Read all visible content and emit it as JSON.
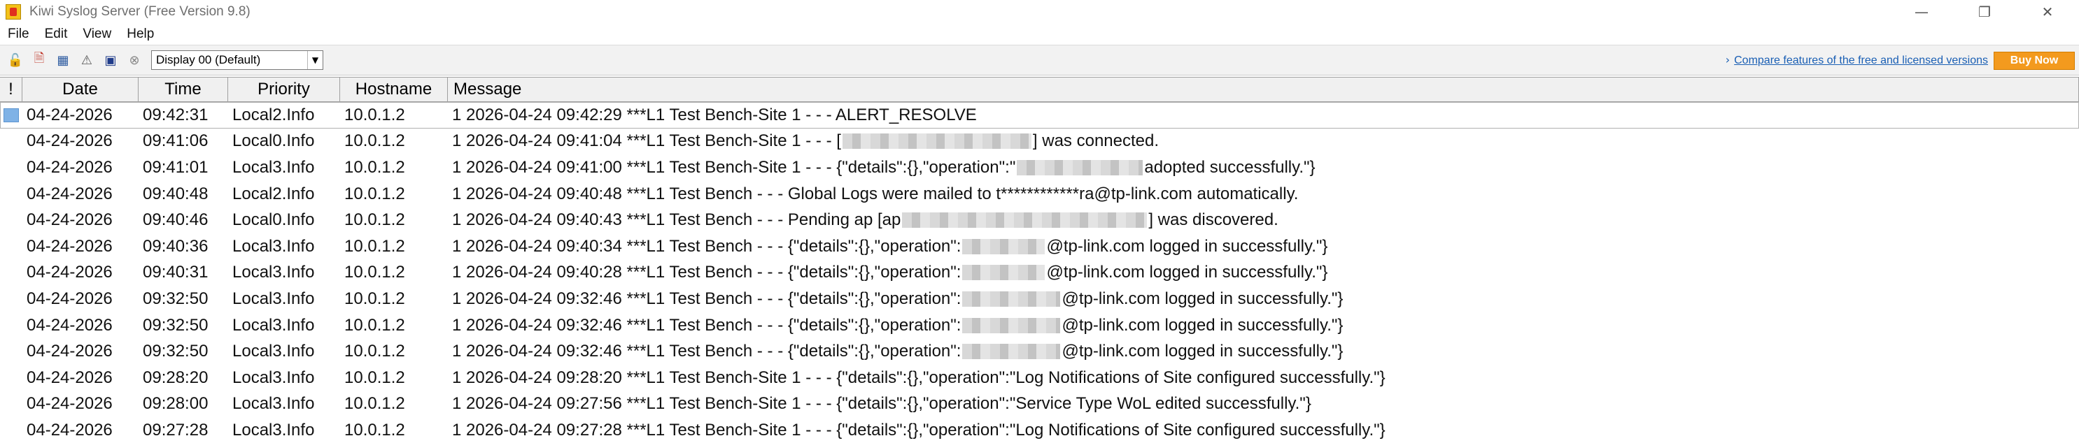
{
  "window": {
    "title": "Kiwi Syslog Server (Free Version 9.8)",
    "controls": {
      "minimize": "—",
      "restore": "❐",
      "close": "✕"
    }
  },
  "menu": {
    "items": [
      "File",
      "Edit",
      "View",
      "Help"
    ]
  },
  "toolbar": {
    "icons": [
      "lock-icon",
      "document-icon",
      "chart-icon",
      "warning-icon",
      "monitor-icon",
      "close-circle-icon"
    ],
    "display_select_value": "Display 00 (Default)",
    "compare_link_text": "Compare features of the free and licensed versions",
    "buy_now_label": "Buy Now"
  },
  "grid": {
    "columns": [
      "!",
      "Date",
      "Time",
      "Priority",
      "Hostname",
      "Message"
    ],
    "rows": [
      {
        "date": "04-24-2026",
        "time": "09:42:31",
        "priority": "Local2.Info",
        "hostname": "10.0.1.2",
        "message_prefix": "1 2026-04-24 09:42:29 ***L1 Test Bench-Site 1 - - - ALERT_RESOLVE",
        "message_suffix": ""
      },
      {
        "date": "04-24-2026",
        "time": "09:41:06",
        "priority": "Local0.Info",
        "hostname": "10.0.1.2",
        "message_prefix": "1 2026-04-24 09:41:04 ***L1 Test Bench-Site 1 - - - [",
        "message_suffix": "] was connected."
      },
      {
        "date": "04-24-2026",
        "time": "09:41:01",
        "priority": "Local3.Info",
        "hostname": "10.0.1.2",
        "message_prefix": "1 2026-04-24 09:41:00 ***L1 Test Bench-Site 1 - - - {\"details\":{},\"operation\":\"",
        "message_suffix": "adopted successfully.\"}"
      },
      {
        "date": "04-24-2026",
        "time": "09:40:48",
        "priority": "Local2.Info",
        "hostname": "10.0.1.2",
        "message_prefix": "1 2026-04-24 09:40:48 ***L1 Test Bench - - - Global Logs were mailed to t************ra@tp-link.com automatically.",
        "message_suffix": ""
      },
      {
        "date": "04-24-2026",
        "time": "09:40:46",
        "priority": "Local0.Info",
        "hostname": "10.0.1.2",
        "message_prefix": "1 2026-04-24 09:40:43 ***L1 Test Bench - - - Pending ap [ap",
        "message_suffix": "] was discovered."
      },
      {
        "date": "04-24-2026",
        "time": "09:40:36",
        "priority": "Local3.Info",
        "hostname": "10.0.1.2",
        "message_prefix": "1 2026-04-24 09:40:34 ***L1 Test Bench - - - {\"details\":{},\"operation\":",
        "message_suffix": "@tp-link.com logged in successfully.\"}"
      },
      {
        "date": "04-24-2026",
        "time": "09:40:31",
        "priority": "Local3.Info",
        "hostname": "10.0.1.2",
        "message_prefix": "1 2026-04-24 09:40:28 ***L1 Test Bench - - - {\"details\":{},\"operation\":",
        "message_suffix": "@tp-link.com logged in successfully.\"}"
      },
      {
        "date": "04-24-2026",
        "time": "09:32:50",
        "priority": "Local3.Info",
        "hostname": "10.0.1.2",
        "message_prefix": "1 2026-04-24 09:32:46 ***L1 Test Bench - - - {\"details\":{},\"operation\":",
        "message_suffix": "@tp-link.com logged in successfully.\"}"
      },
      {
        "date": "04-24-2026",
        "time": "09:32:50",
        "priority": "Local3.Info",
        "hostname": "10.0.1.2",
        "message_prefix": "1 2026-04-24 09:32:46 ***L1 Test Bench - - - {\"details\":{},\"operation\":",
        "message_suffix": "@tp-link.com logged in successfully.\"}"
      },
      {
        "date": "04-24-2026",
        "time": "09:32:50",
        "priority": "Local3.Info",
        "hostname": "10.0.1.2",
        "message_prefix": "1 2026-04-24 09:32:46 ***L1 Test Bench - - - {\"details\":{},\"operation\":",
        "message_suffix": "@tp-link.com logged in successfully.\"}"
      },
      {
        "date": "04-24-2026",
        "time": "09:28:20",
        "priority": "Local3.Info",
        "hostname": "10.0.1.2",
        "message_prefix": "1 2026-04-24 09:28:20 ***L1 Test Bench-Site 1 - - - {\"details\":{},\"operation\":\"Log Notifications of Site configured successfully.\"}",
        "message_suffix": ""
      },
      {
        "date": "04-24-2026",
        "time": "09:28:00",
        "priority": "Local3.Info",
        "hostname": "10.0.1.2",
        "message_prefix": "1 2026-04-24 09:27:56 ***L1 Test Bench-Site 1 - - - {\"details\":{},\"operation\":\"Service Type WoL edited successfully.\"}",
        "message_suffix": ""
      },
      {
        "date": "04-24-2026",
        "time": "09:27:28",
        "priority": "Local3.Info",
        "hostname": "10.0.1.2",
        "message_prefix": "1 2026-04-24 09:27:28 ***L1 Test Bench-Site 1 - - - {\"details\":{},\"operation\":\"Log Notifications of Site configured successfully.\"}",
        "message_suffix": ""
      }
    ]
  },
  "colors": {
    "selection_marker": "#7fb2e6",
    "buy_now_bg": "#f39a1e",
    "link": "#1a5fb4"
  }
}
